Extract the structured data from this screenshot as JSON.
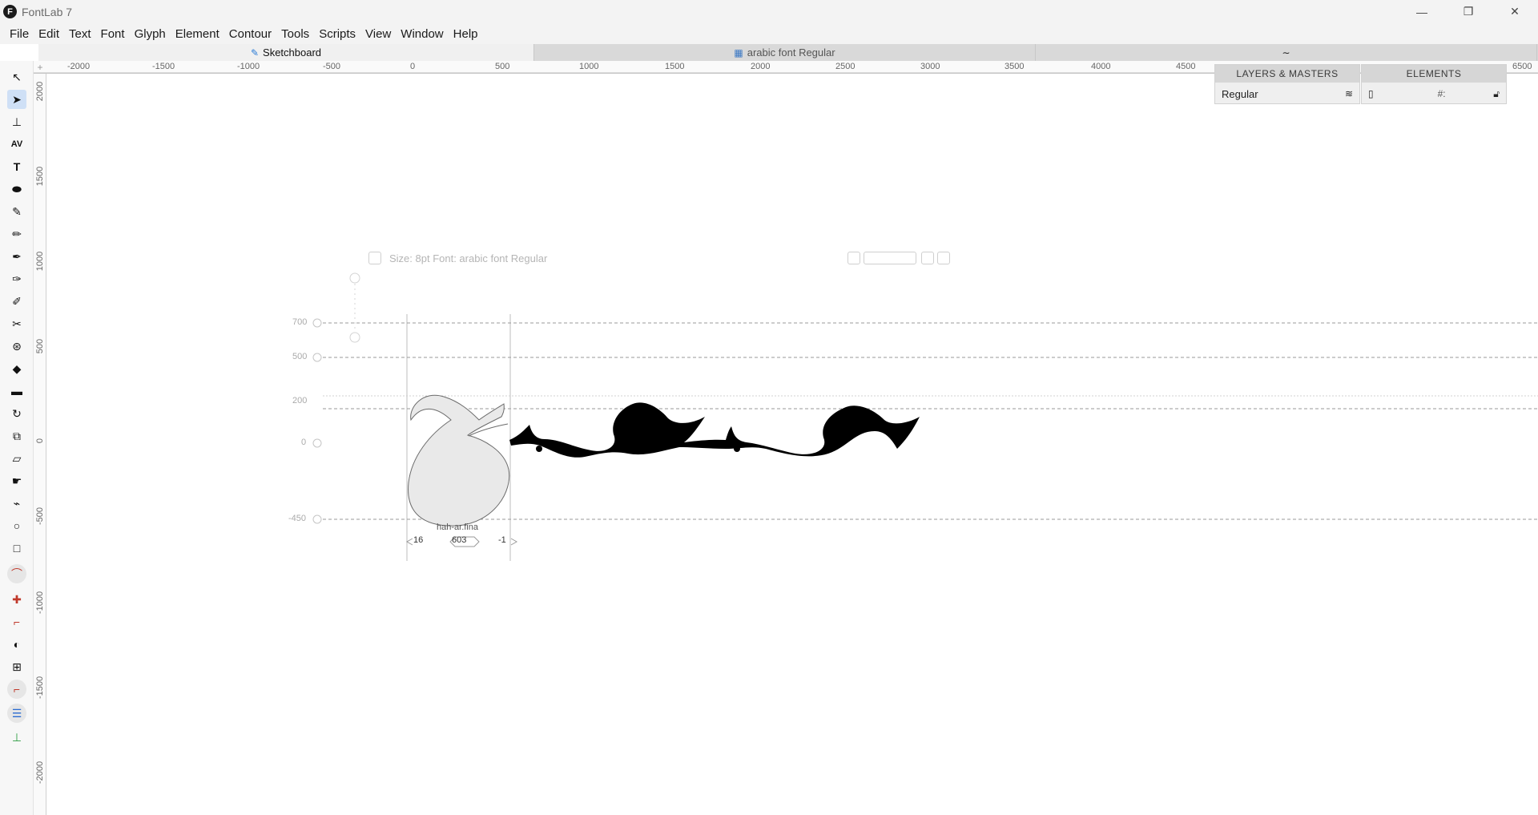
{
  "window": {
    "title": "FontLab 7",
    "logo_letter": "F",
    "controls": {
      "minimize": "—",
      "maximize": "❐",
      "close": "✕"
    }
  },
  "menu": [
    "File",
    "Edit",
    "Text",
    "Font",
    "Glyph",
    "Element",
    "Contour",
    "Tools",
    "Scripts",
    "View",
    "Window",
    "Help"
  ],
  "tabs": [
    {
      "label": "Sketchboard",
      "icon": "sketch-icon",
      "active": true
    },
    {
      "label": "arabic font Regular",
      "icon": "grid-icon",
      "active": false
    },
    {
      "label": "",
      "icon": "glyph-preview-icon",
      "active": false
    }
  ],
  "ruler": {
    "top_labels": [
      "-2000",
      "-1500",
      "-1000",
      "-500",
      "0",
      "500",
      "1000",
      "1500",
      "2000",
      "2500",
      "3000",
      "3500",
      "4000",
      "4500",
      "6500"
    ],
    "left_labels": [
      "2000",
      "1500",
      "1000",
      "500",
      "0",
      "-500",
      "-1000",
      "-1500",
      "-2000"
    ]
  },
  "panels": {
    "layers": {
      "title": "LAYERS & MASTERS",
      "row_label": "Regular"
    },
    "elements": {
      "title": "ELEMENTS",
      "field_label": "#:"
    }
  },
  "canvas": {
    "info_line": "Size: 8pt   Font: arabic font Regular",
    "vmetrics": [
      "700",
      "500",
      "200",
      "0",
      "-450"
    ],
    "glyph_name": "hah-ar.fina",
    "lsb": "16",
    "advance": "603",
    "rsb": "-1"
  },
  "colors": {
    "accent": "#cfe0f6",
    "ink": "#000000",
    "selection_fill": "#e6e6e6"
  }
}
